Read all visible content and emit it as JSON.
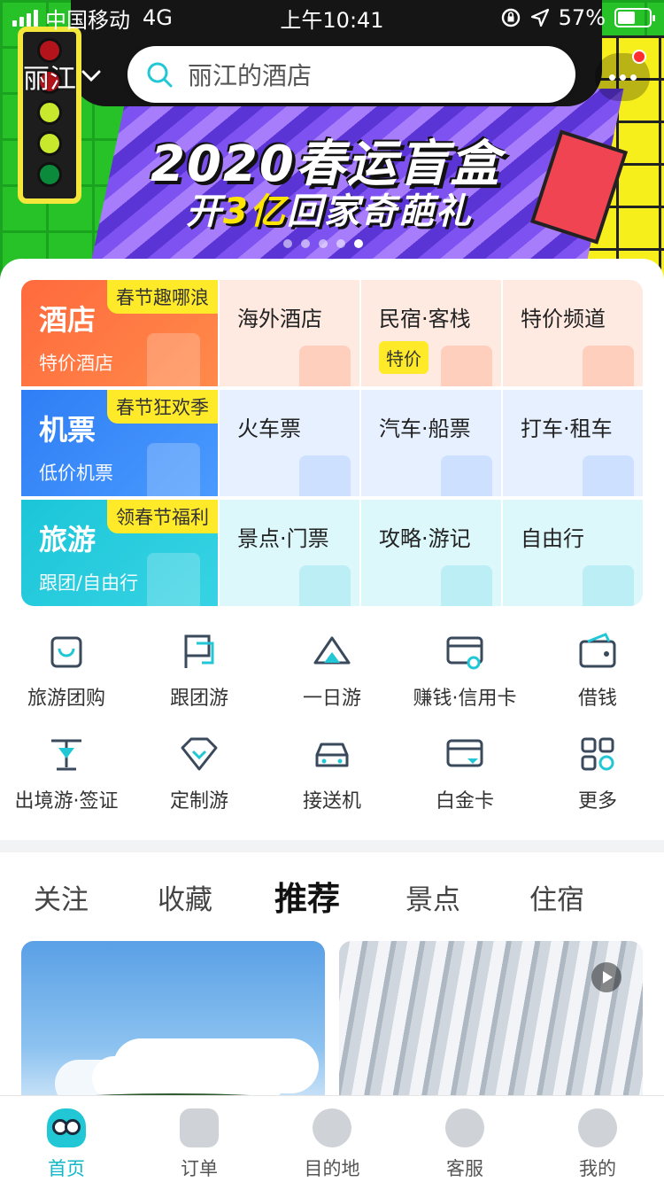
{
  "status_bar": {
    "carrier": "中国移动",
    "network": "4G",
    "time": "上午10:41",
    "battery": "57%",
    "battery_level": 0.57
  },
  "header": {
    "city": "丽江",
    "search_placeholder": "丽江的酒店"
  },
  "banner": {
    "title_line1": "2020春运盲盒",
    "title_line2_a": "开",
    "title_line2_hl": "3亿",
    "title_line2_b": "回家奇葩礼",
    "page_count": 5,
    "active_page": 5
  },
  "services": [
    {
      "title": "酒店",
      "subtitle": "特价酒店",
      "tag": "春节趣哪浪",
      "items": [
        {
          "label": "海外酒店",
          "badge": ""
        },
        {
          "label": "民宿·客栈",
          "badge": "特价"
        },
        {
          "label": "特价频道",
          "badge": ""
        }
      ]
    },
    {
      "title": "机票",
      "subtitle": "低价机票",
      "tag": "春节狂欢季",
      "items": [
        {
          "label": "火车票",
          "badge": ""
        },
        {
          "label": "汽车·船票",
          "badge": ""
        },
        {
          "label": "打车·租车",
          "badge": ""
        }
      ]
    },
    {
      "title": "旅游",
      "subtitle": "跟团/自由行",
      "tag": "领春节福利",
      "items": [
        {
          "label": "景点·门票",
          "badge": ""
        },
        {
          "label": "攻略·游记",
          "badge": ""
        },
        {
          "label": "自由行",
          "badge": ""
        }
      ]
    }
  ],
  "shortcuts": [
    {
      "label": "旅游团购",
      "icon": "shopping-bag-icon"
    },
    {
      "label": "跟团游",
      "icon": "flag-icon"
    },
    {
      "label": "一日游",
      "icon": "mountain-icon"
    },
    {
      "label": "赚钱·信用卡",
      "icon": "credit-card-icon"
    },
    {
      "label": "借钱",
      "icon": "wallet-icon"
    },
    {
      "label": "出境游·签证",
      "icon": "landmark-icon"
    },
    {
      "label": "定制游",
      "icon": "diamond-icon"
    },
    {
      "label": "接送机",
      "icon": "car-icon"
    },
    {
      "label": "白金卡",
      "icon": "card-icon"
    },
    {
      "label": "更多",
      "icon": "grid-icon"
    }
  ],
  "feed_tabs": [
    "关注",
    "收藏",
    "推荐",
    "景点",
    "住宿"
  ],
  "feed_active_tab": "推荐",
  "tabbar": [
    {
      "label": "首页",
      "icon": "home-mascot-icon",
      "active": true
    },
    {
      "label": "订单",
      "icon": "order-icon",
      "active": false
    },
    {
      "label": "目的地",
      "icon": "location-pin-icon",
      "active": false
    },
    {
      "label": "客服",
      "icon": "chat-icon",
      "active": false
    },
    {
      "label": "我的",
      "icon": "profile-icon",
      "active": false
    }
  ],
  "colors": {
    "accent": "#22c7d6",
    "hotel": "#ff6a3d",
    "flight": "#2f7ef5",
    "travel": "#1bc6d8",
    "tag_yellow": "#ffea2a"
  }
}
